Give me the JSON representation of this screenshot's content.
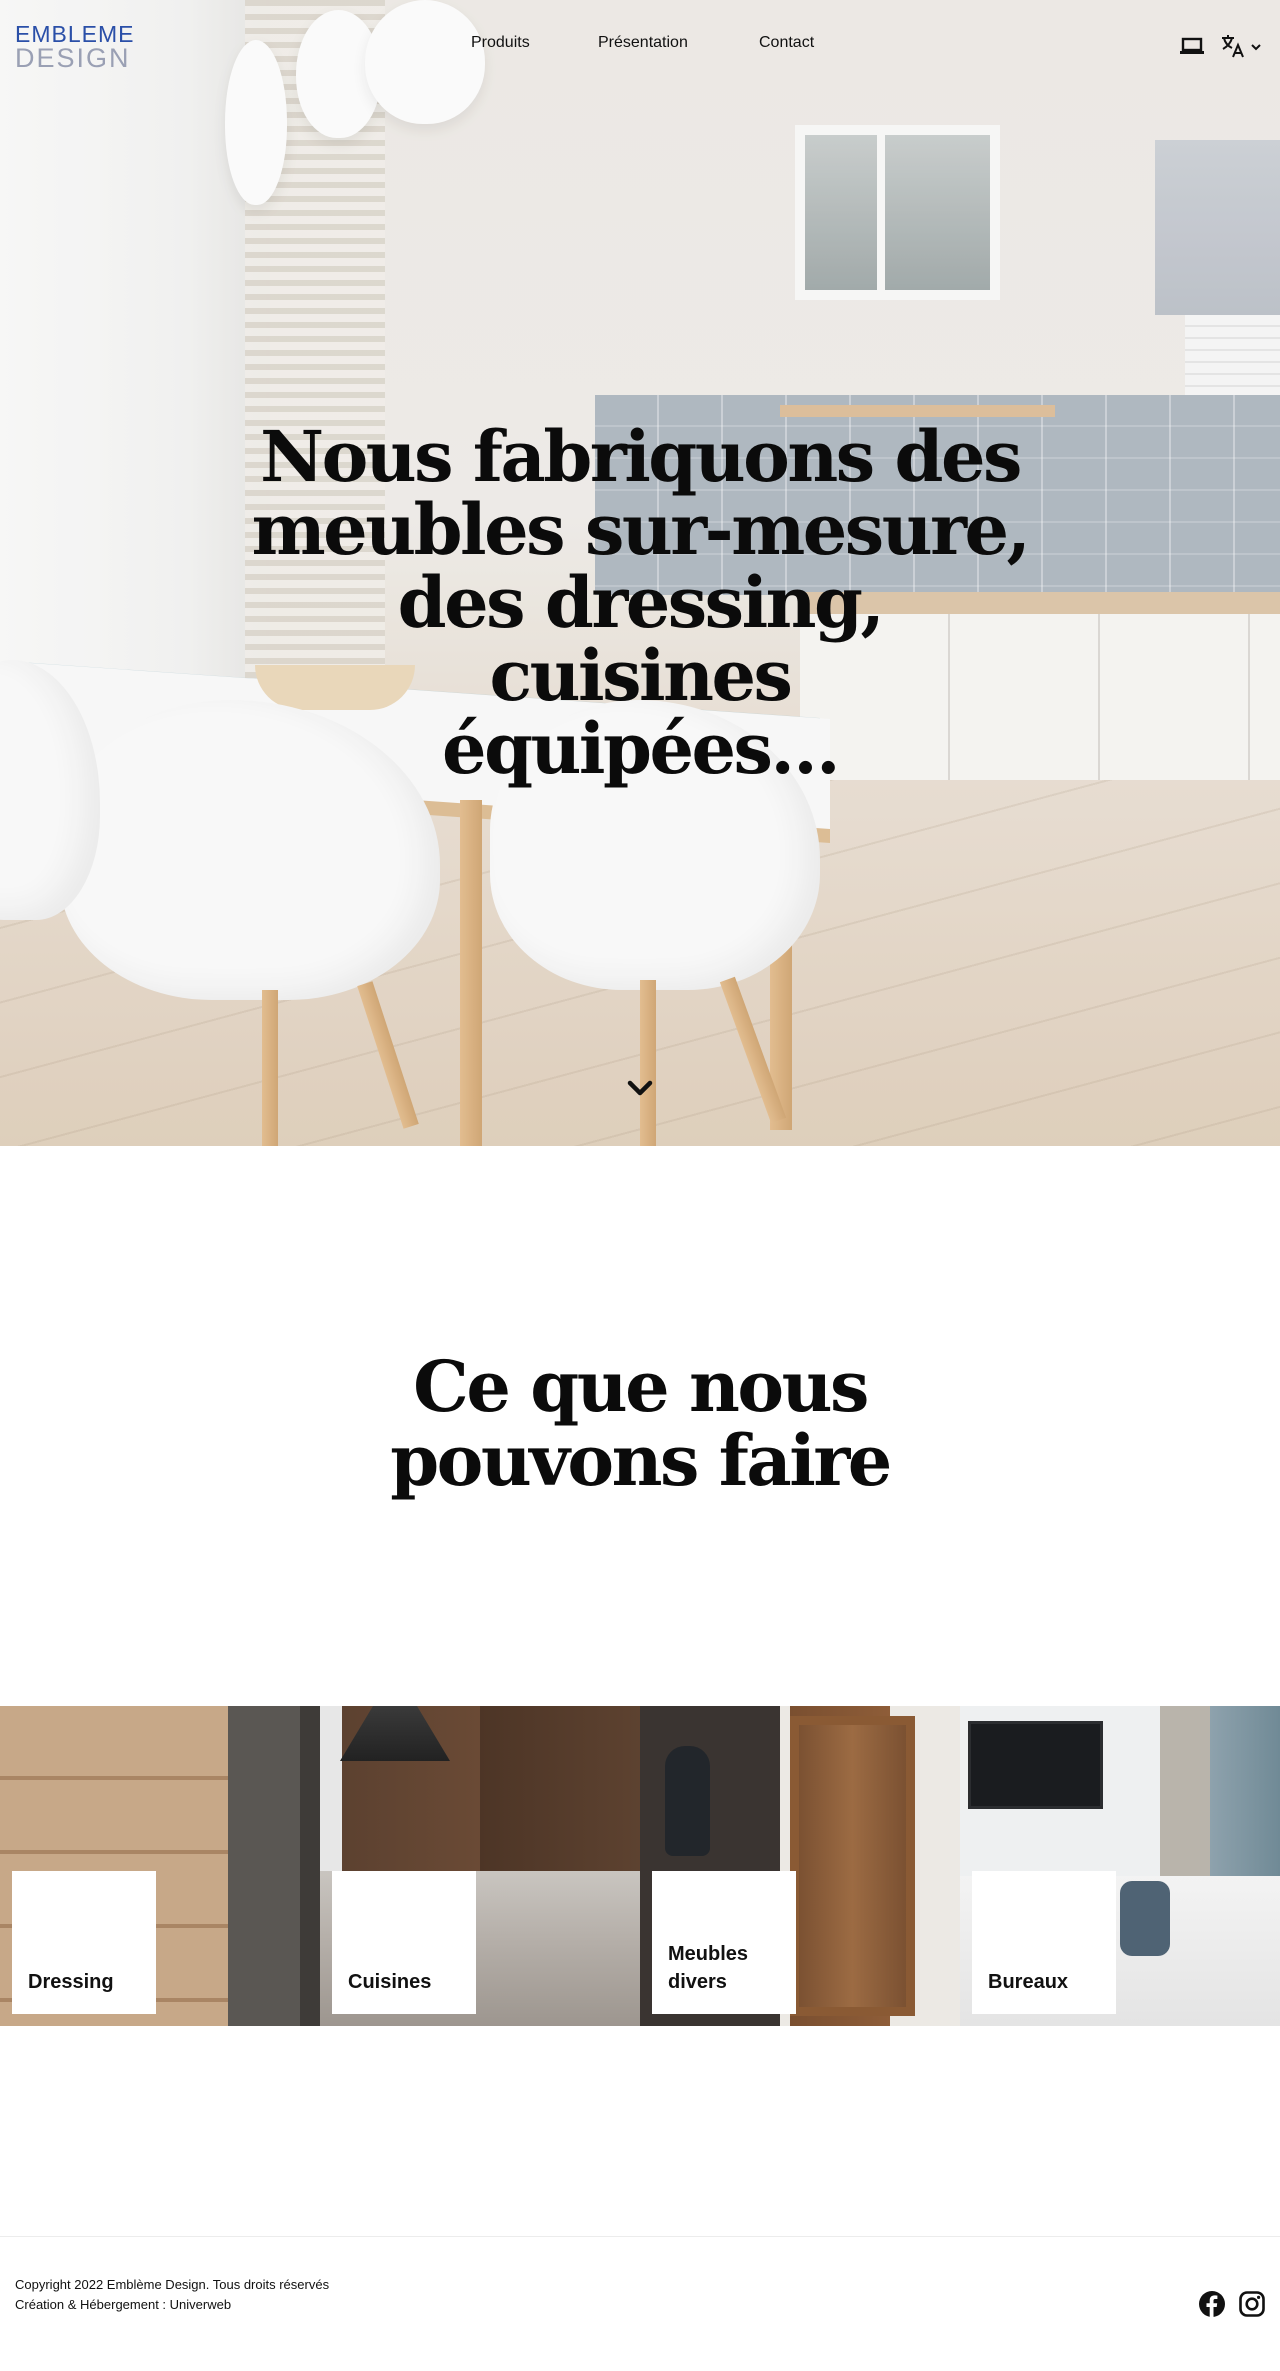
{
  "brand": {
    "logo_top": "EMBLEME",
    "logo_bottom": "DESIGN",
    "colors": {
      "logo_blue": "#2a4fa8",
      "logo_grey": "#9aa0b4",
      "text": "#111111"
    }
  },
  "nav": {
    "items": [
      {
        "label": "Produits"
      },
      {
        "label": "Présentation"
      },
      {
        "label": "Contact"
      }
    ],
    "device_icon": "laptop-icon",
    "language_icon": "translate-icon",
    "language_caret_icon": "chevron-down-icon"
  },
  "hero": {
    "title_lines": [
      "Nous fabriquons des",
      "meubles sur-mesure,",
      "des dressing, cuisines",
      "équipées…"
    ],
    "scroll_icon": "chevron-down-icon"
  },
  "services": {
    "title_lines": [
      "Ce que nous",
      "pouvons faire"
    ],
    "cards": [
      {
        "label_lines": [
          "Dressing"
        ]
      },
      {
        "label_lines": [
          "Cuisines"
        ]
      },
      {
        "label_lines": [
          "Meubles",
          "divers"
        ]
      },
      {
        "label_lines": [
          "Bureaux"
        ]
      }
    ]
  },
  "footer": {
    "copyright": "Copyright 2022 Emblème Design. Tous droits réservés",
    "credit": "Création & Hébergement : Univerweb",
    "social": [
      "facebook-icon",
      "instagram-icon"
    ]
  }
}
